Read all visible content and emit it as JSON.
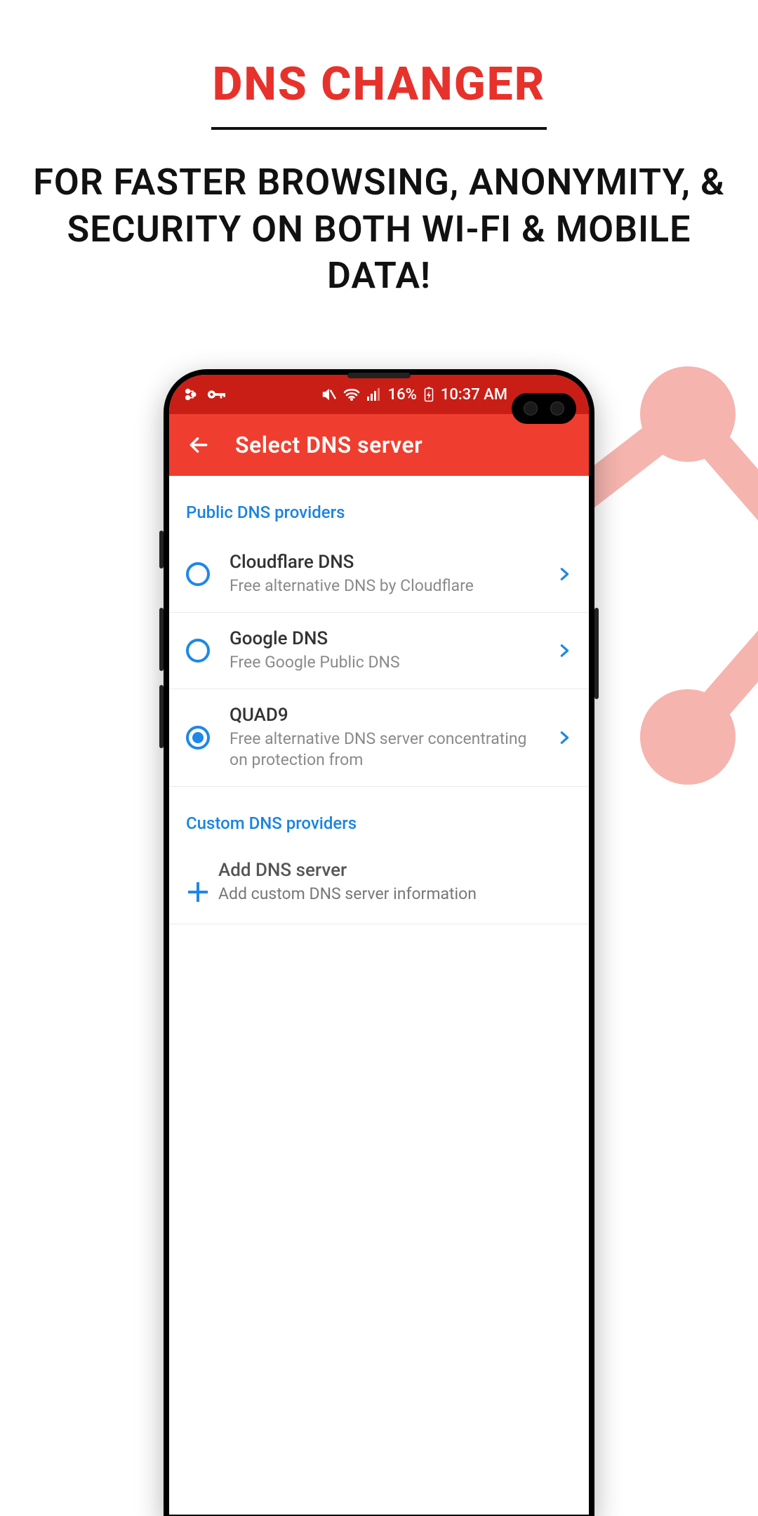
{
  "hero": {
    "title": "DNS CHANGER",
    "subtitle": "FOR FASTER BROWSING, ANONYMITY, & SECURITY ON BOTH WI-FI & MOBILE DATA!"
  },
  "status_bar": {
    "left_icons": [
      "settings-icon",
      "key-icon"
    ],
    "right_icons": [
      "mute-icon",
      "wifi-icon",
      "signal-icon"
    ],
    "battery_pct": "16%",
    "time": "10:37 AM"
  },
  "app_bar": {
    "title": "Select DNS server"
  },
  "sections": {
    "public": {
      "header": "Public DNS providers",
      "items": [
        {
          "title": "Cloudflare DNS",
          "subtitle": "Free alternative DNS by Cloudflare",
          "selected": false
        },
        {
          "title": "Google DNS",
          "subtitle": "Free Google Public DNS",
          "selected": false
        },
        {
          "title": "QUAD9",
          "subtitle": "Free alternative DNS server concentrating on protection from",
          "selected": true
        }
      ]
    },
    "custom": {
      "header": "Custom DNS providers",
      "add_title": "Add DNS server",
      "add_subtitle": "Add custom DNS server information"
    }
  }
}
